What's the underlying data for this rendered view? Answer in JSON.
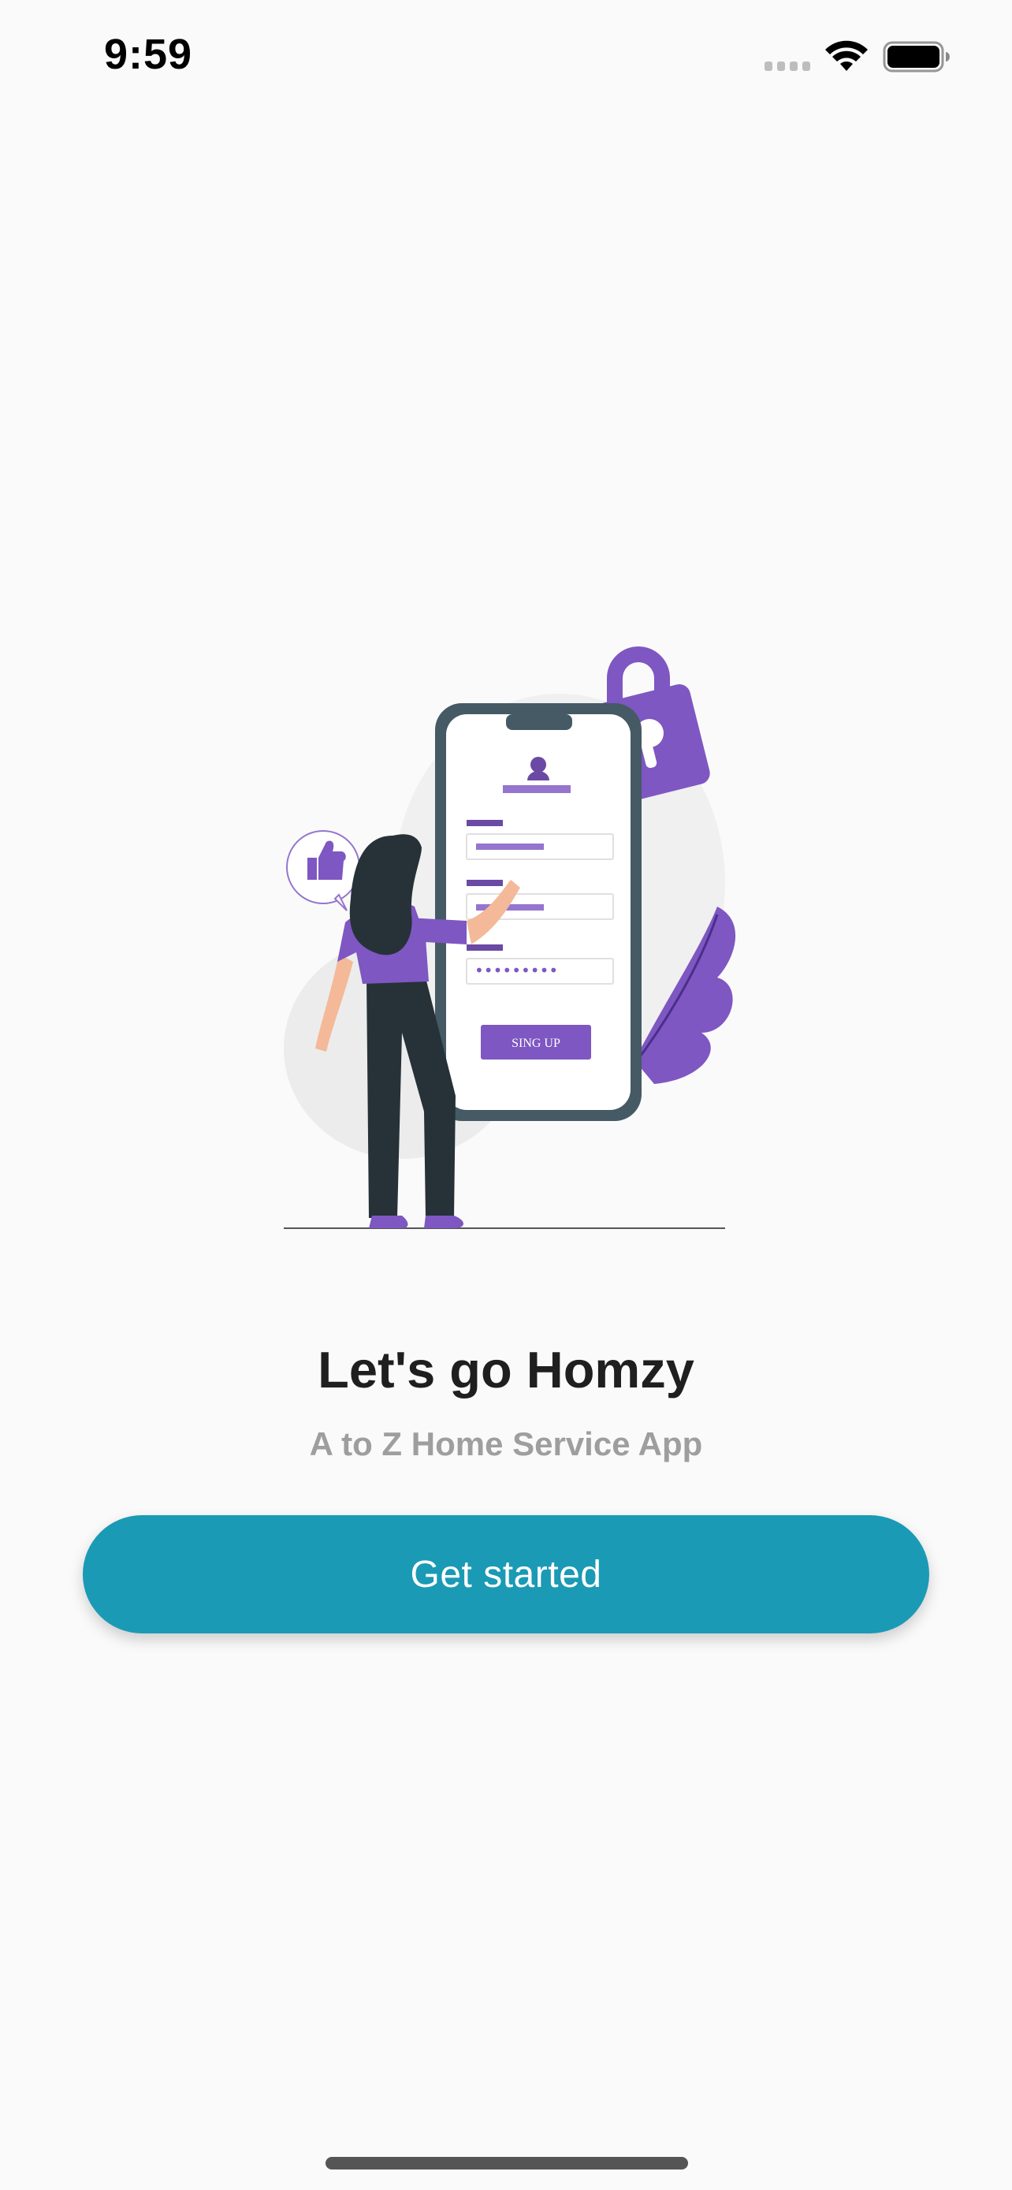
{
  "status_bar": {
    "time": "9:59",
    "icons": [
      "signal-icon",
      "wifi-icon",
      "battery-icon"
    ]
  },
  "illustration": {
    "form_button_label": "SING UP",
    "password_mask": "•••••••••",
    "accent_color": "#7e57c2"
  },
  "onboarding": {
    "title": "Let's go Homzy",
    "subtitle": "A to Z Home Service App",
    "cta_label": "Get started"
  },
  "colors": {
    "background": "#fafafa",
    "cta": "#1a9ab5",
    "accent": "#7e57c2",
    "title": "#1f1f1f",
    "subtitle": "#9e9e9e"
  }
}
